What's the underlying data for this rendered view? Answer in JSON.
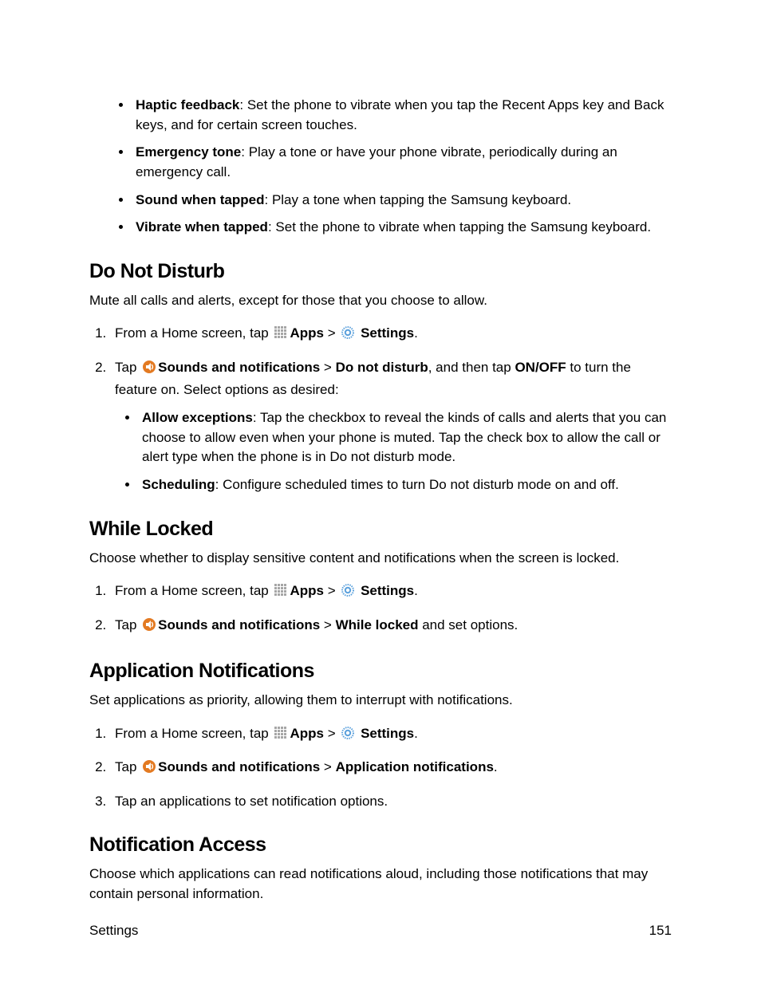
{
  "top_bullets": [
    {
      "term": "Haptic feedback",
      "desc": ": Set the phone to vibrate when you tap the Recent Apps key and Back keys, and for certain screen touches."
    },
    {
      "term": "Emergency tone",
      "desc": ": Play a tone or have your phone vibrate, periodically during an emergency call."
    },
    {
      "term": "Sound when tapped",
      "desc": ": Play a tone when tapping the Samsung keyboard."
    },
    {
      "term": "Vibrate when tapped",
      "desc": ": Set the phone to vibrate when tapping the Samsung keyboard."
    }
  ],
  "common": {
    "from_home_prefix": "From a Home screen, tap ",
    "apps_label": "Apps",
    "gt": " > ",
    "settings_label": " Settings",
    "period": ".",
    "tap_prefix": "Tap ",
    "sounds_label": "Sounds and notifications"
  },
  "dnd": {
    "heading": "Do Not Disturb",
    "intro": "Mute all calls and alerts, except for those that you choose to allow.",
    "step2_mid": "Do not disturb",
    "step2_after_mid": ", and then tap ",
    "step2_onoff": "ON/OFF",
    "step2_tail": " to turn the feature on. Select options as desired:",
    "bullets": [
      {
        "term": "Allow exceptions",
        "desc": ": Tap the checkbox to reveal the kinds of calls and alerts that you can choose to allow even when your phone is muted. Tap the check box to allow the call or alert type when the phone is in Do not disturb mode."
      },
      {
        "term": "Scheduling",
        "desc": ": Configure scheduled times to turn Do not disturb mode on and off."
      }
    ]
  },
  "while_locked": {
    "heading": "While Locked",
    "intro": "Choose whether to display sensitive content and notifications when the screen is locked.",
    "step2_mid": "While locked",
    "step2_tail": " and set options."
  },
  "app_notif": {
    "heading": "Application Notifications",
    "intro": "Set applications as priority, allowing them to interrupt with notifications.",
    "step2_mid": "Application notifications",
    "step3": "Tap an applications to set notification options."
  },
  "notif_access": {
    "heading": "Notification Access",
    "intro": "Choose which applications can read notifications aloud, including those notifications that may contain personal information."
  },
  "footer": {
    "left": "Settings",
    "right": "151"
  }
}
